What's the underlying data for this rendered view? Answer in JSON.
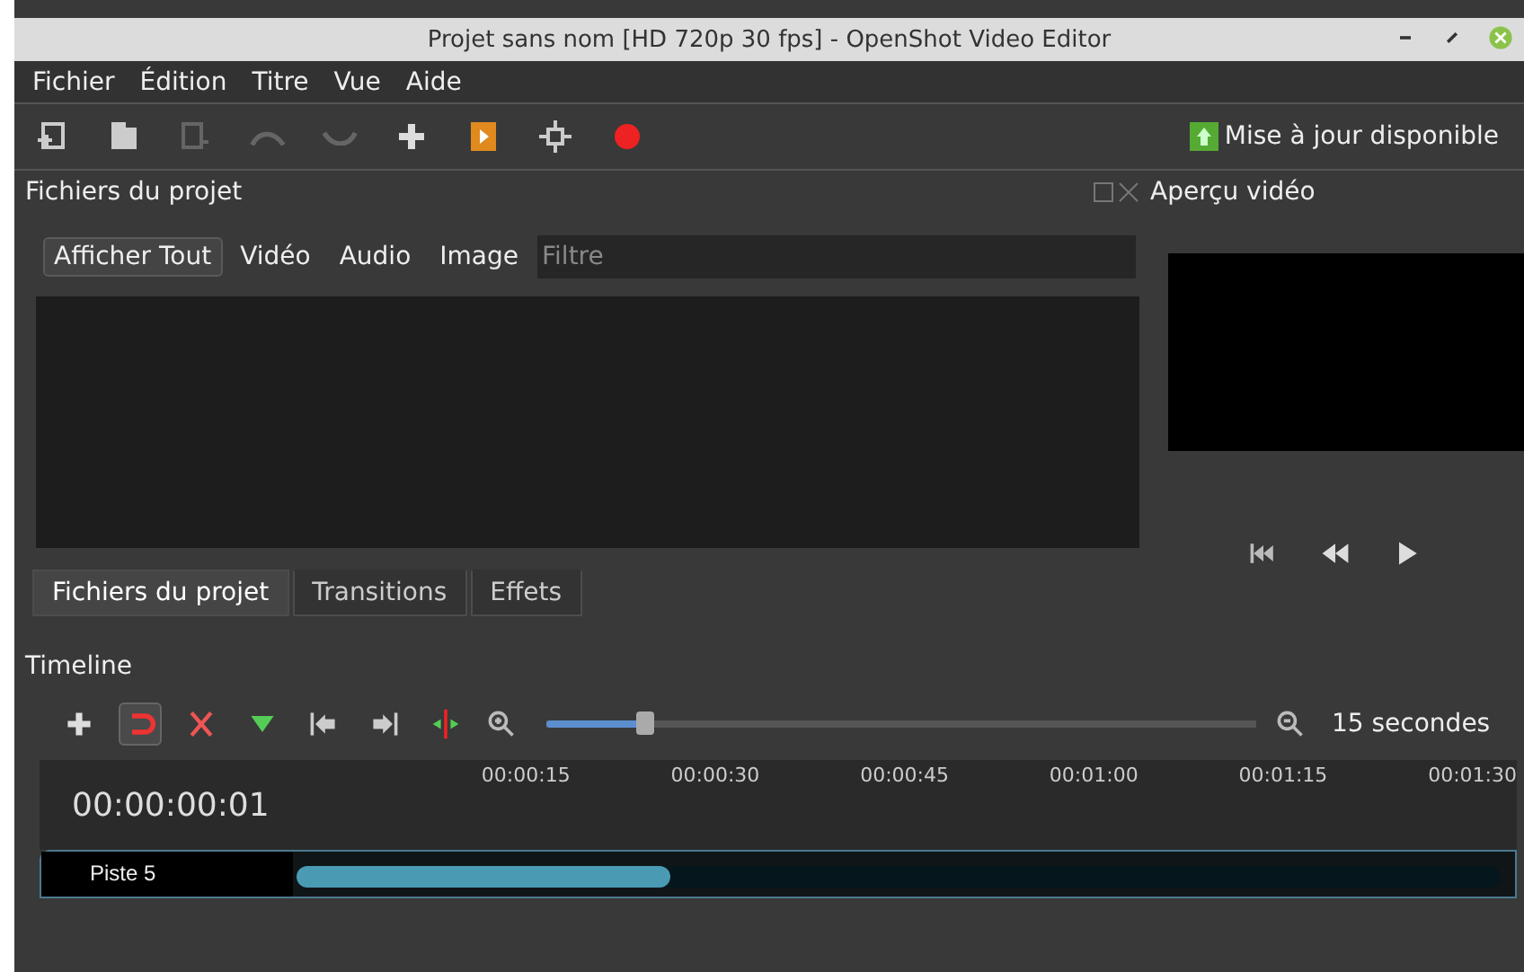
{
  "window": {
    "title": "Projet sans nom [HD 720p 30 fps] - OpenShot Video Editor"
  },
  "menu": [
    {
      "label": "Fichier"
    },
    {
      "label": "Édition"
    },
    {
      "label": "Titre"
    },
    {
      "label": "Vue"
    },
    {
      "label": "Aide"
    }
  ],
  "toolbar": {
    "buttons": [
      {
        "kind": "import",
        "disabled": false
      },
      {
        "kind": "profile",
        "disabled": false
      },
      {
        "kind": "export-list",
        "disabled": true
      },
      {
        "kind": "undo",
        "disabled": true
      },
      {
        "kind": "redo",
        "disabled": true
      },
      {
        "kind": "add",
        "disabled": false
      },
      {
        "kind": "film",
        "disabled": false
      },
      {
        "kind": "fullscreen",
        "disabled": false
      },
      {
        "kind": "record",
        "disabled": false
      }
    ],
    "update": "Mise à jour disponible"
  },
  "project_files": {
    "title": "Fichiers du projet",
    "filters": [
      {
        "label": "Afficher Tout",
        "selected": true
      },
      {
        "label": "Vidéo",
        "selected": false
      },
      {
        "label": "Audio",
        "selected": false
      },
      {
        "label": "Image",
        "selected": false
      }
    ],
    "search": {
      "placeholder": "Filtre"
    },
    "tabs": [
      {
        "label": "Fichiers du projet",
        "selected": true
      },
      {
        "label": "Transitions",
        "selected": false
      },
      {
        "label": "Effets",
        "selected": false
      }
    ]
  },
  "preview": {
    "title": "Aperçu vidéo"
  },
  "timeline": {
    "title": "Timeline",
    "tools": [
      {
        "kind": "add",
        "selected": false
      },
      {
        "kind": "snap",
        "selected": true
      },
      {
        "kind": "razor",
        "selected": false
      },
      {
        "kind": "marker",
        "selected": false
      },
      {
        "kind": "prev",
        "selected": false
      },
      {
        "kind": "next",
        "selected": false
      },
      {
        "kind": "center",
        "selected": false
      }
    ],
    "zoom": {
      "level": 0.14,
      "label": "15 secondes"
    },
    "time": "00:00:00:01",
    "ticks": [
      "00:00:15",
      "00:00:30",
      "00:00:45",
      "00:01:00",
      "00:01:15",
      "00:01:30"
    ],
    "tracks": [
      {
        "name": "Piste 5"
      }
    ]
  }
}
